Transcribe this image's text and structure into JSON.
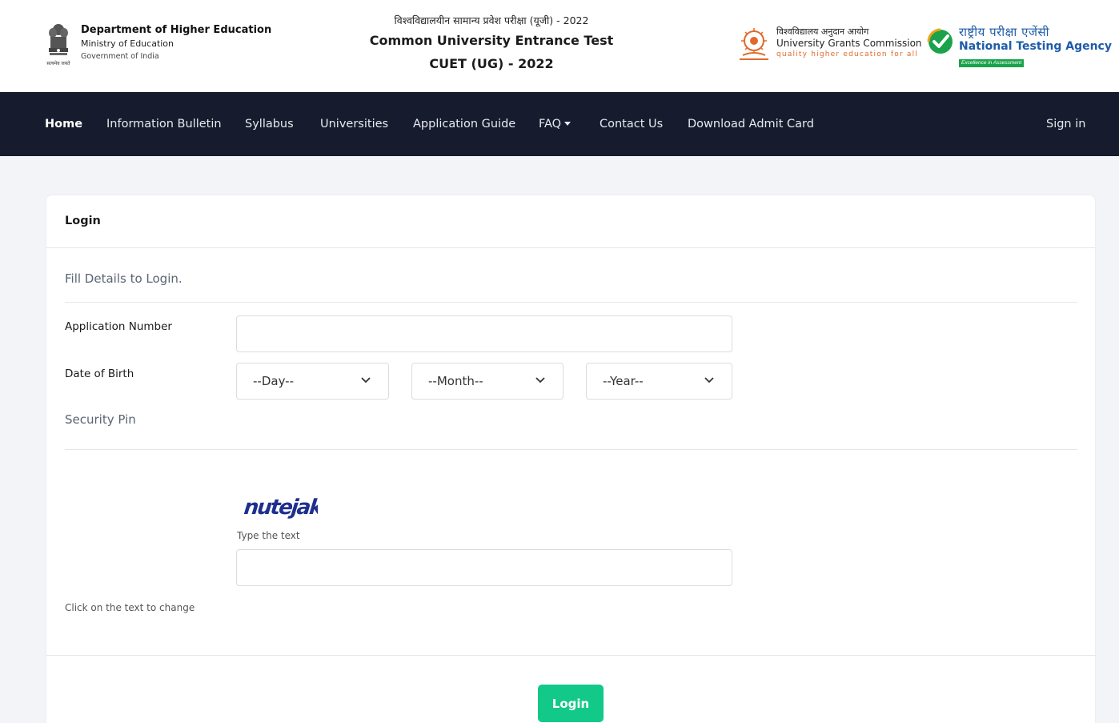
{
  "header": {
    "dept_title": "Department of Higher Education",
    "dept_ministry": "Ministry of Education",
    "dept_govt": "Government of India",
    "emblem_caption": "सत्यमेव जयते",
    "hindi_title": "विश्वविद्यालयीन सामान्य प्रवेश परीक्षा (यूजी) - 2022",
    "title": "Common University Entrance Test",
    "subtitle": "CUET (UG) - 2022",
    "ugc_hindi": "विश्वविद्यालय अनुदान आयोग",
    "ugc_english": "University Grants Commission",
    "ugc_tagline": "quality higher education for all",
    "nta_hindi": "राष्ट्रीय परीक्षा एजेंसी",
    "nta_english": "National Testing Agency",
    "nta_tagline": "Excellence in Assessment"
  },
  "nav": {
    "items": [
      "Home",
      "Information Bulletin",
      "Syllabus",
      "Universities",
      "Application Guide",
      "FAQ",
      "Contact Us",
      "Download Admit Card"
    ],
    "sign_in": "Sign in"
  },
  "login": {
    "card_title": "Login",
    "fill_details": "Fill Details to Login.",
    "app_number_label": "Application Number",
    "app_number_value": "",
    "dob_label": "Date of Birth",
    "day_value": "--Day--",
    "month_value": "--Month--",
    "year_value": "--Year--",
    "security_pin_label": "Security Pin",
    "captcha_text": "nutejak",
    "type_text_label": "Type the text",
    "captcha_input_value": "",
    "click_change": "Click on the text to change",
    "login_button": "Login"
  },
  "colors": {
    "nav_bg": "#161c2d",
    "page_bg": "#f3f4f8",
    "login_button": "#13c98a",
    "nta_blue": "#1d5ca8",
    "ugc_orange": "#e06a2a",
    "captcha_color": "#1f2f8f"
  },
  "icons": [
    "national-emblem-icon",
    "ugc-logo-icon",
    "nta-check-icon",
    "caret-down-icon",
    "chevron-down-icon"
  ]
}
